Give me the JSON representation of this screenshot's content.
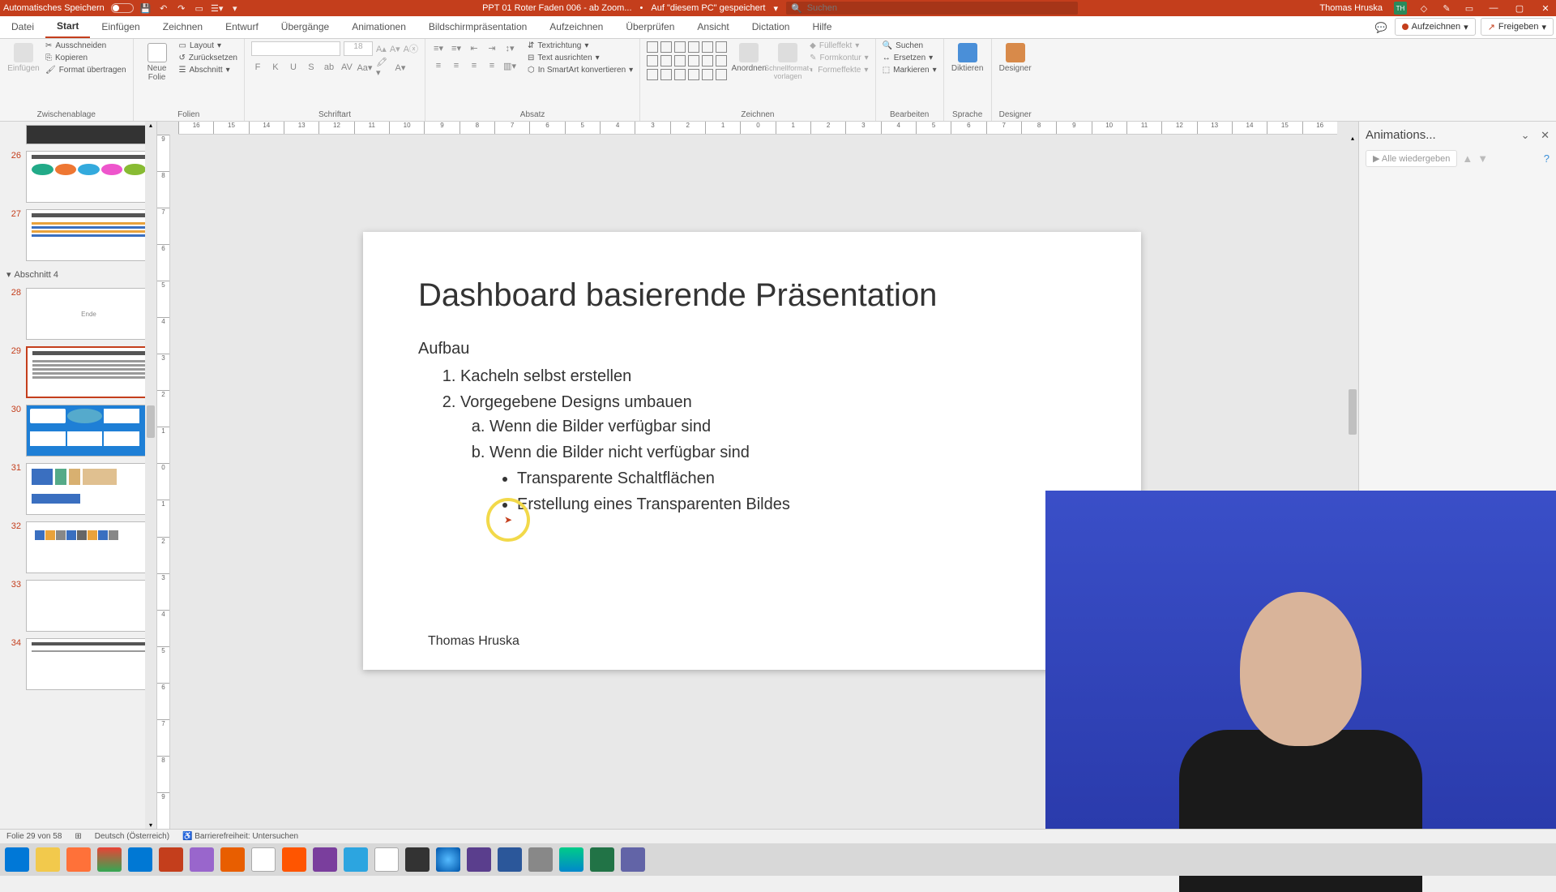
{
  "titlebar": {
    "autosave": "Automatisches Speichern",
    "filename": "PPT 01 Roter Faden 006 - ab Zoom...",
    "saved": "Auf \"diesem PC\" gespeichert",
    "search_placeholder": "Suchen",
    "user": "Thomas Hruska",
    "user_initials": "TH"
  },
  "tabs": {
    "datei": "Datei",
    "start": "Start",
    "einfuegen": "Einfügen",
    "zeichnen": "Zeichnen",
    "entwurf": "Entwurf",
    "uebergaenge": "Übergänge",
    "animationen": "Animationen",
    "bildschirm": "Bildschirmpräsentation",
    "aufzeichnen": "Aufzeichnen",
    "ueberpruefen": "Überprüfen",
    "ansicht": "Ansicht",
    "dictation": "Dictation",
    "hilfe": "Hilfe",
    "record_btn": "Aufzeichnen",
    "share_btn": "Freigeben"
  },
  "ribbon": {
    "zwischenablage": {
      "label": "Zwischenablage",
      "einfuegen": "Einfügen",
      "ausschneiden": "Ausschneiden",
      "kopieren": "Kopieren",
      "format": "Format übertragen"
    },
    "folien": {
      "label": "Folien",
      "neue": "Neue\nFolie",
      "layout": "Layout",
      "zuruecksetzen": "Zurücksetzen",
      "abschnitt": "Abschnitt"
    },
    "schriftart": {
      "label": "Schriftart",
      "size": "18",
      "bold": "F",
      "italic": "K",
      "underline": "U",
      "strike": "S"
    },
    "absatz": {
      "label": "Absatz",
      "textrichtung": "Textrichtung",
      "textausrichten": "Text ausrichten",
      "smartart": "In SmartArt konvertieren"
    },
    "zeichnen": {
      "label": "Zeichnen",
      "anordnen": "Anordnen",
      "schnell": "Schnellformat-\nvorlagen",
      "fuell": "Fülleffekt",
      "kontur": "Formkontur",
      "effekte": "Formeffekte"
    },
    "bearbeiten": {
      "label": "Bearbeiten",
      "suchen": "Suchen",
      "ersetzen": "Ersetzen",
      "markieren": "Markieren"
    },
    "sprache": {
      "label": "Sprache",
      "diktieren": "Diktieren"
    },
    "designer": {
      "label": "Designer",
      "designer": "Designer"
    }
  },
  "slides": {
    "section4": "Abschnitt 4",
    "nums": {
      "s26": "26",
      "s27": "27",
      "s28": "28",
      "s29": "29",
      "s30": "30",
      "s31": "31",
      "s32": "32",
      "s33": "33",
      "s34": "34"
    },
    "ende": "Ende"
  },
  "slide": {
    "title": "Dashboard basierende Präsentation",
    "sub": "Aufbau",
    "li1": "Kacheln selbst erstellen",
    "li2": "Vorgegebene Designs umbauen",
    "li2a": "Wenn  die Bilder verfügbar sind",
    "li2b": "Wenn die Bilder nicht verfügbar sind",
    "b1": "Transparente Schaltflächen",
    "b2": "Erstellung eines Transparenten Bildes",
    "author": "Thomas Hruska"
  },
  "ruler_h": [
    "16",
    "15",
    "14",
    "13",
    "12",
    "11",
    "10",
    "9",
    "8",
    "7",
    "6",
    "5",
    "4",
    "3",
    "2",
    "1",
    "0",
    "1",
    "2",
    "3",
    "4",
    "5",
    "6",
    "7",
    "8",
    "9",
    "10",
    "11",
    "12",
    "13",
    "14",
    "15",
    "16"
  ],
  "ruler_v": [
    "9",
    "8",
    "7",
    "6",
    "5",
    "4",
    "3",
    "2",
    "1",
    "0",
    "1",
    "2",
    "3",
    "4",
    "5",
    "6",
    "7",
    "8",
    "9"
  ],
  "anim": {
    "title": "Animations...",
    "play": "Alle wiedergeben"
  },
  "status": {
    "slide": "Folie 29 von 58",
    "lang": "Deutsch (Österreich)",
    "access": "Barrierefreiheit: Untersuchen"
  }
}
